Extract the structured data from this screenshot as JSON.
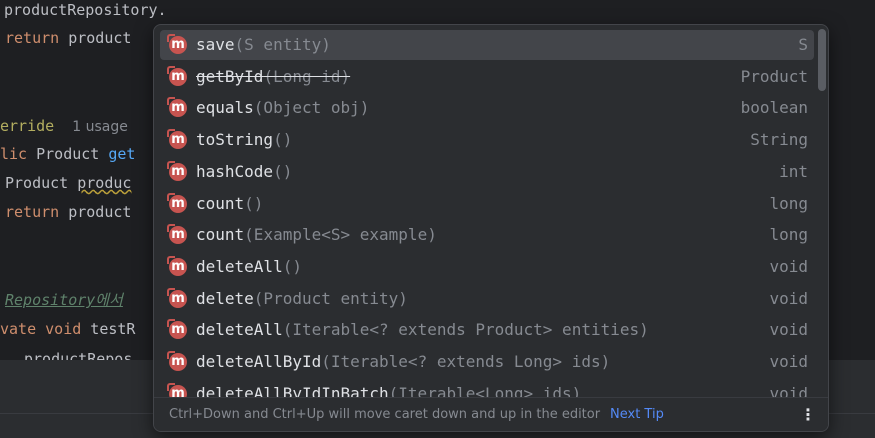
{
  "editor": {
    "line1": "productRepository.",
    "line2_kw": "return",
    "line2_rest": " product",
    "line5_ann": "erride",
    "line5_hint": "1 usage",
    "line6_kw": "lic",
    "line6_type": " Product ",
    "line6_fn": "get",
    "line7_type": "Product ",
    "line7_var": "produc",
    "line8_kw": "return",
    "line8_rest": " product",
    "line10_comment": "Repository에서",
    "line11_kw": "vate void",
    "line11_rest": " testR",
    "line12": "productRepos"
  },
  "popup": {
    "items": [
      {
        "name": "save",
        "params": "(S entity)",
        "type": "S"
      },
      {
        "name": "getById",
        "params": "(Long id)",
        "type": "Product"
      },
      {
        "name": "equals",
        "params": "(Object obj)",
        "type": "boolean"
      },
      {
        "name": "toString",
        "params": "()",
        "type": "String"
      },
      {
        "name": "hashCode",
        "params": "()",
        "type": "int"
      },
      {
        "name": "count",
        "params": "()",
        "type": "long"
      },
      {
        "name": "count",
        "params": "(Example<S> example)",
        "type": "long"
      },
      {
        "name": "deleteAll",
        "params": "()",
        "type": "void"
      },
      {
        "name": "delete",
        "params": "(Product entity)",
        "type": "void"
      },
      {
        "name": "deleteAll",
        "params": "(Iterable<? extends Product> entities)",
        "type": "void"
      },
      {
        "name": "deleteAllById",
        "params": "(Iterable<? extends Long> ids)",
        "type": "void"
      },
      {
        "name": "deleteAllByIdInBatch",
        "params": "(Iterable<Long> ids)",
        "type": "void"
      }
    ],
    "icon_glyph": "m",
    "icon_name": "method-icon",
    "footer_tip": "Ctrl+Down and Ctrl+Up will move caret down and up in the editor",
    "next_tip": "Next Tip",
    "more_glyph": "⋮"
  },
  "colors": {
    "accent": "#548af7",
    "method_icon": "#c75450",
    "selected_row": "#43454a",
    "popup_bg": "#2b2d30",
    "editor_bg": "#1e1f22"
  }
}
